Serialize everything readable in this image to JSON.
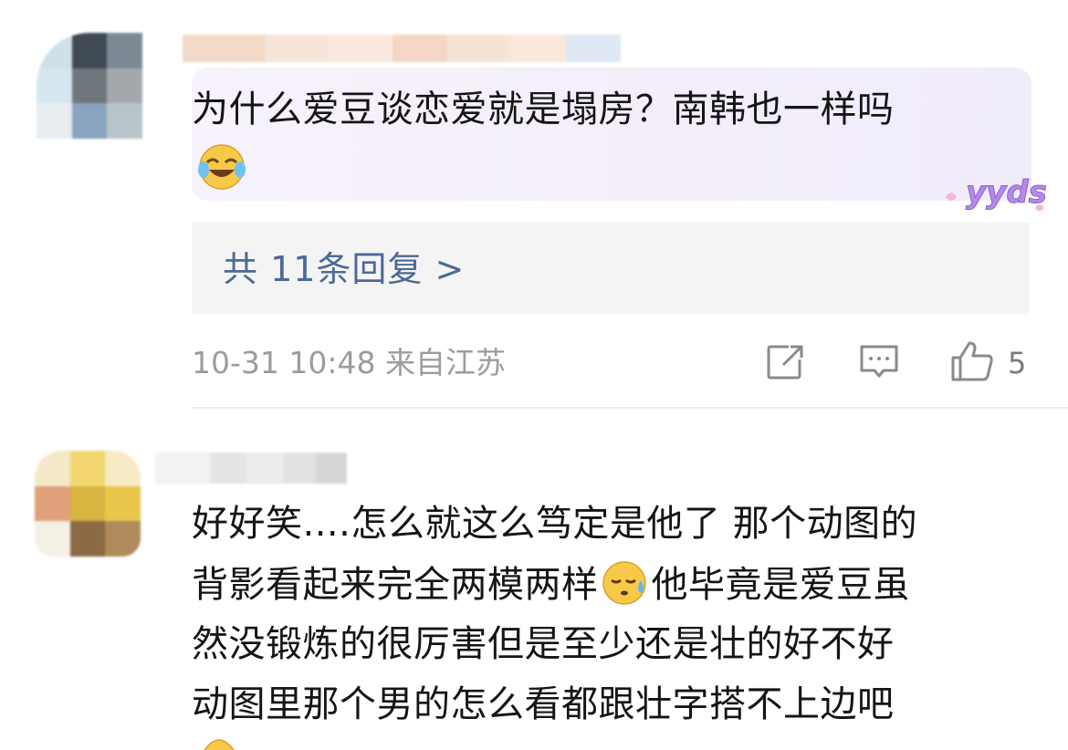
{
  "comment1": {
    "text": "为什么爱豆谈恋爱就是塌房？南韩也一样吗",
    "emoji": "laughing-tears-icon",
    "sticker_text": "yyds",
    "replies_label": "共 11条回复 >",
    "time": "10-31 10:48",
    "location": "来自江苏",
    "like_count": "5",
    "icons": [
      "share-icon",
      "comment-icon",
      "like-icon"
    ]
  },
  "comment2": {
    "lines": [
      "好好笑....怎么就这么笃定是他了 那个动图的",
      "他毕竟是爱豆虽",
      "然没锻炼的很厉害但是至少还是壮的好不好",
      "动图里那个男的怎么看都跟壮字搭不上边吧"
    ],
    "line2_prefix": "背影看起来完全两模两样",
    "emoji": "sweat-face-icon"
  },
  "colors": {
    "link": "#4d6a95",
    "meta": "#9c9c9c",
    "bubble": "#f5f0fa",
    "reply_bg": "#f4f4f4"
  }
}
